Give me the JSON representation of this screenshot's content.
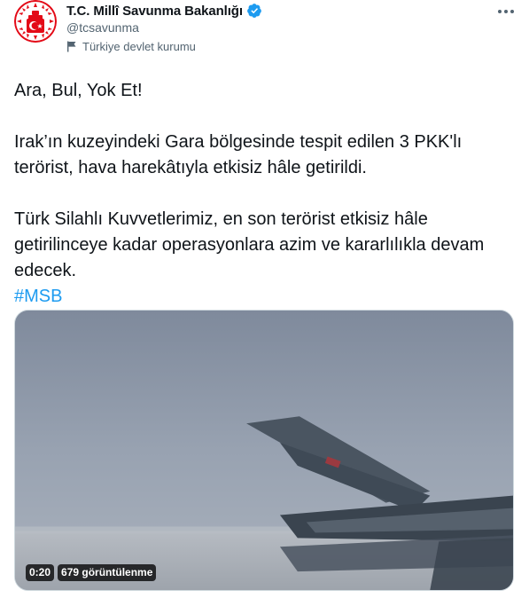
{
  "author": {
    "name": "T.C. Millî Savunma Bakanlığı",
    "handle": "@tcsavunma",
    "label": "Türkiye devlet kurumu"
  },
  "tweet": {
    "line1": "Ara, Bul, Yok Et!",
    "line2": "Irak’ın kuzeyindeki Gara bölgesinde tespit edilen 3 PKK'lı terörist, hava harekâtıyla etkisiz hâle getirildi.",
    "line3": "Türk Silahlı Kuvvetlerimiz, en son terörist etkisiz hâle getirilinceye kadar operasyonlara azim ve kararlılıkla devam edecek.",
    "hashtag": "#MSB"
  },
  "video": {
    "duration": "0:20",
    "views": "679 görüntülenme"
  },
  "icons": {
    "avatar": "ministry-emblem-icon",
    "verified": "verified-badge-icon",
    "label": "flag-icon",
    "more": "more-options-icon"
  },
  "colors": {
    "accent": "#1d9bf0",
    "emblem_red": "#e30a17",
    "secondary_text": "#536471"
  }
}
